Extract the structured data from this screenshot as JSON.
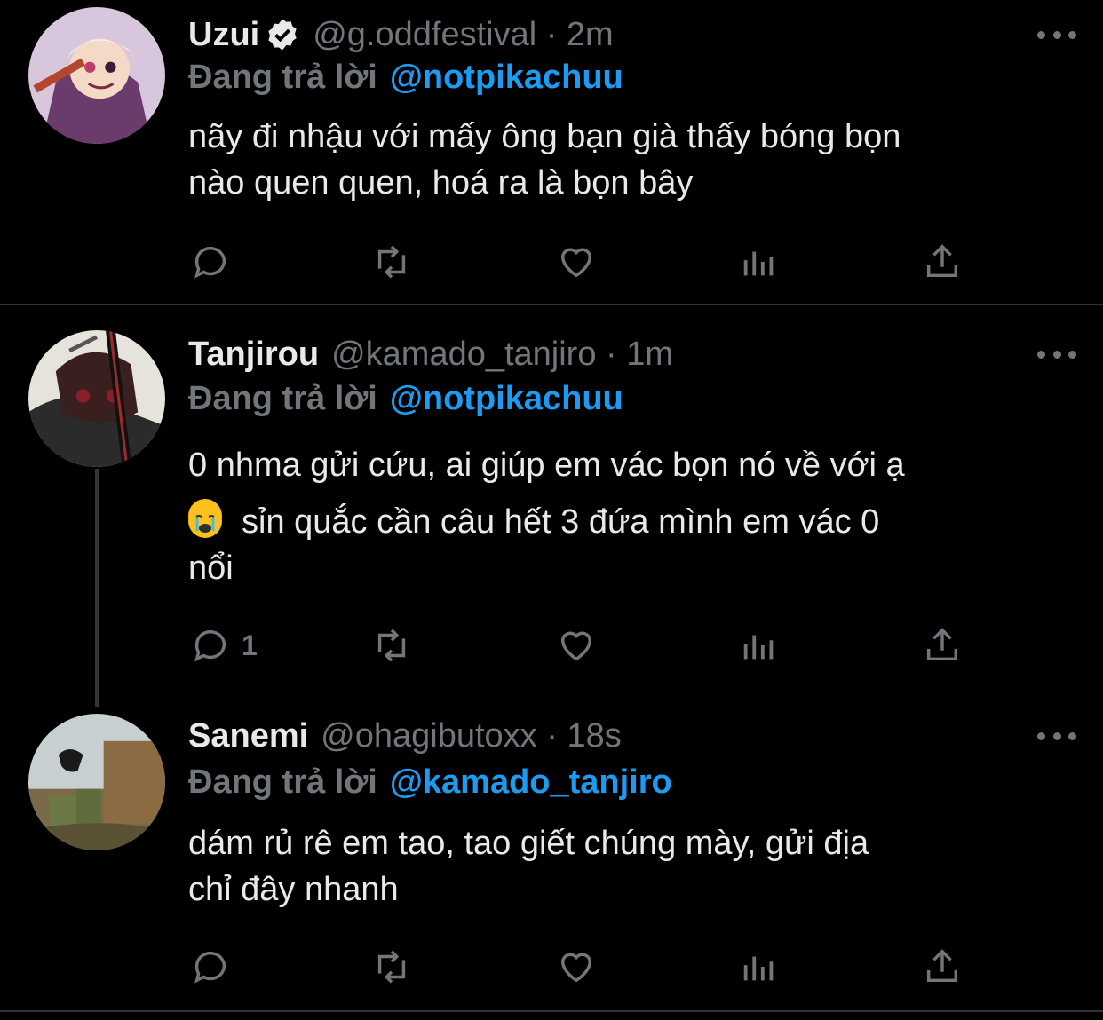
{
  "tweets": [
    {
      "name": "Uzui",
      "verified": true,
      "handle": "@g.oddfestival · 2m",
      "reply_label": "Đang trả lời",
      "reply_to": "@notpikachuu",
      "text": [
        "nãy đi nhậu với mấy ông bạn già thấy bóng bọn",
        "nào quen quen, hoá ra là bọn bây"
      ],
      "reply_count": ""
    },
    {
      "name": "Tanjirou",
      "verified": false,
      "handle": "@kamado_tanjiro · 1m",
      "reply_label": "Đang trả lời",
      "reply_to": "@notpikachuu",
      "text": [
        "0 nhma gửi cứu, ai giúp em vác bọn nó về với ạ",
        "sỉn quắc cần câu hết 3 đứa mình em vác 0",
        "nổi"
      ],
      "emoji": "loudly-crying-face",
      "reply_count": "1"
    },
    {
      "name": "Sanemi",
      "verified": false,
      "handle": "@ohagibutoxx · 18s",
      "reply_label": "Đang trả lời",
      "reply_to": "@kamado_tanjiro",
      "text": [
        "dám rủ rê em tao, tao giết chúng mày, gửi địa",
        "chỉ đây nhanh"
      ],
      "reply_count": ""
    }
  ],
  "icons": [
    "reply-icon",
    "retweet-icon",
    "like-icon",
    "views-icon",
    "share-icon",
    "more-icon",
    "verified-icon"
  ],
  "colors": {
    "background": "#000000",
    "text": "#e7e9ea",
    "muted": "#71767b",
    "link": "#1d9bf0",
    "divider": "#2f3336"
  }
}
